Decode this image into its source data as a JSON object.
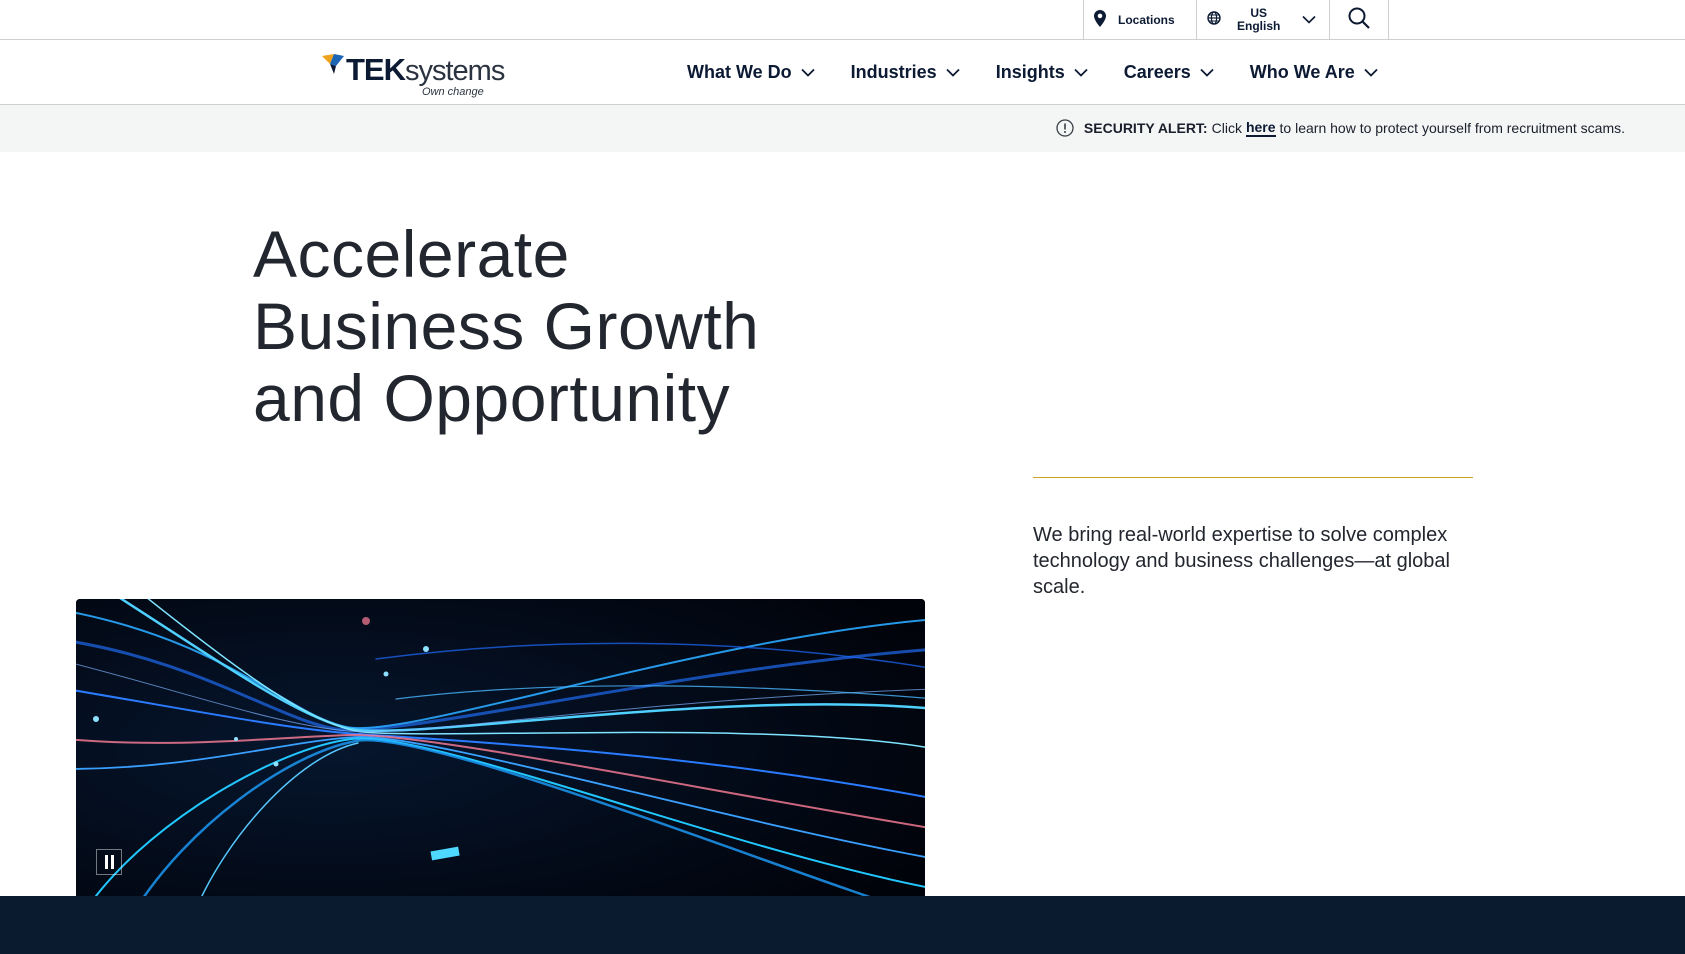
{
  "utility": {
    "locations_label": "Locations",
    "region": "US",
    "language": "English"
  },
  "logo": {
    "brand_bold": "TEK",
    "brand_light": "systems",
    "tagline": "Own change"
  },
  "nav": {
    "items": [
      {
        "label": "What We Do"
      },
      {
        "label": "Industries"
      },
      {
        "label": "Insights"
      },
      {
        "label": "Careers"
      },
      {
        "label": "Who We Are"
      }
    ]
  },
  "alert": {
    "heading": "SECURITY ALERT:",
    "before_link": "Click",
    "link": "here",
    "after_link": "to learn how to protect yourself from recruitment scams."
  },
  "hero": {
    "title": "Accelerate Business Growth and Opportunity",
    "subtitle": "We bring real-world expertise to solve complex technology and business challenges—at global scale."
  },
  "colors": {
    "navy": "#0c1a33",
    "gold": "#c9a227",
    "alert_bg": "#f4f5f5",
    "footer": "#0a1a2f"
  },
  "icons": {
    "locations": "map-pin-icon",
    "language": "globe-icon",
    "dropdown": "chevron-down-icon",
    "search": "search-icon",
    "alert": "exclamation-circle-icon",
    "video_control": "pause-icon"
  }
}
